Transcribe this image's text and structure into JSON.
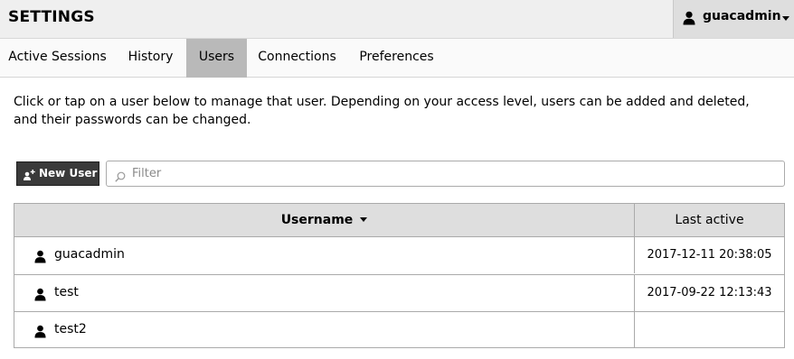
{
  "header": {
    "title": "SETTINGS",
    "user_menu": {
      "icon": "user-icon",
      "username": "guacadmin",
      "caret_icon": "caret-down-icon"
    }
  },
  "tabs": [
    {
      "label": "Active Sessions",
      "active": false
    },
    {
      "label": "History",
      "active": false
    },
    {
      "label": "Users",
      "active": true
    },
    {
      "label": "Connections",
      "active": false
    },
    {
      "label": "Preferences",
      "active": false
    }
  ],
  "intro_text": "Click or tap on a user below to manage that user. Depending on your access level, users can be added and deleted, and their passwords can be changed.",
  "toolbar": {
    "new_user_label": "New User",
    "new_user_icon": "add-user-icon",
    "filter_placeholder": "Filter",
    "filter_value": "",
    "filter_icon": "search-icon"
  },
  "table": {
    "columns": [
      {
        "label": "Username",
        "sorted": "descending"
      },
      {
        "label": "Last active"
      }
    ],
    "rows": [
      {
        "username": "guacadmin",
        "last_active": "2017-12-11 20:38:05",
        "icon": "user-icon"
      },
      {
        "username": "test",
        "last_active": "2017-09-22 12:13:43",
        "icon": "user-icon"
      },
      {
        "username": "test2",
        "last_active": "",
        "icon": "user-icon"
      }
    ]
  },
  "colors": {
    "header_bg": "#efefef",
    "active_tab_bg": "#b9b9b9",
    "button_bg": "#3a3a3a",
    "table_header_bg": "#dedede",
    "border": "#aaaaaa"
  }
}
